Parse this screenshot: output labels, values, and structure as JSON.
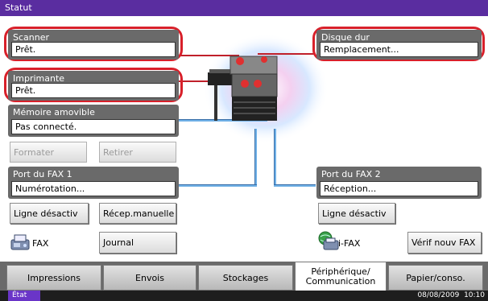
{
  "window": {
    "title": "Statut"
  },
  "scanner": {
    "label": "Scanner",
    "status": "Prêt."
  },
  "printer": {
    "label": "Imprimante",
    "status": "Prêt."
  },
  "disk": {
    "label": "Disque dur",
    "status": "Remplacement..."
  },
  "removable_memory": {
    "label": "Mémoire amovible",
    "status": "Pas connecté.",
    "format_button": "Formater",
    "remove_button": "Retirer"
  },
  "fax_port1": {
    "label": "Port du FAX 1",
    "status": "Numérotation...",
    "line_off_button": "Ligne désactiv",
    "manual_receive_button": "Récep.manuelle"
  },
  "fax_port2": {
    "label": "Port du FAX 2",
    "status": "Réception...",
    "line_off_button": "Ligne désactiv"
  },
  "fax": {
    "label": "FAX",
    "log_button": "Journal"
  },
  "ifax": {
    "label": "i-FAX",
    "check_button": "Vérif nouv FAX"
  },
  "tabs": [
    {
      "label": "Impressions"
    },
    {
      "label": "Envois"
    },
    {
      "label": "Stockages"
    },
    {
      "label": "Périphérique/ Communication"
    },
    {
      "label": "Papier/conso."
    }
  ],
  "status_bar": {
    "state": "État",
    "date": "08/08/2009",
    "time": "10:10"
  },
  "colors": {
    "title_bar": "#5a2da0",
    "highlight": "#d8202a",
    "panel": "#6a6a6a",
    "pipe": "#6fb0e6"
  },
  "icons": {
    "fax": "fax-machine-icon",
    "ifax": "internet-fax-icon",
    "device": "mfp-printer-icon"
  }
}
